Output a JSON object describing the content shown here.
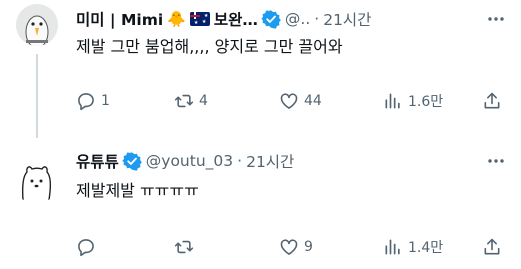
{
  "tweets": [
    {
      "name": "미미 | Mimi",
      "name_suffix": "보완…",
      "handle": "@..",
      "time": "21시간",
      "text": "제발 그만 붐업해,,,, 양지로 그만 끌어와",
      "replies": "1",
      "retweets": "4",
      "likes": "44",
      "views": "1.6만"
    },
    {
      "name": "유튜튜",
      "handle": "@youtu_03",
      "time": "21시간",
      "text": "제발제발 ㅠㅠㅠㅠ",
      "replies": "",
      "retweets": "",
      "likes": "9",
      "views": "1.4만"
    }
  ],
  "separator": "·",
  "icons": {
    "reply": "reply-icon",
    "retweet": "retweet-icon",
    "like": "heart-icon",
    "views": "views-icon",
    "share": "share-icon",
    "more": "more-icon",
    "verified": "verified-badge-icon",
    "chick": "chick-emoji",
    "flag": "australia-flag-emoji"
  },
  "colors": {
    "text": "#0f1419",
    "secondary": "#536471",
    "verified": "#1d9bf0",
    "thread_line": "#cfd9de"
  }
}
